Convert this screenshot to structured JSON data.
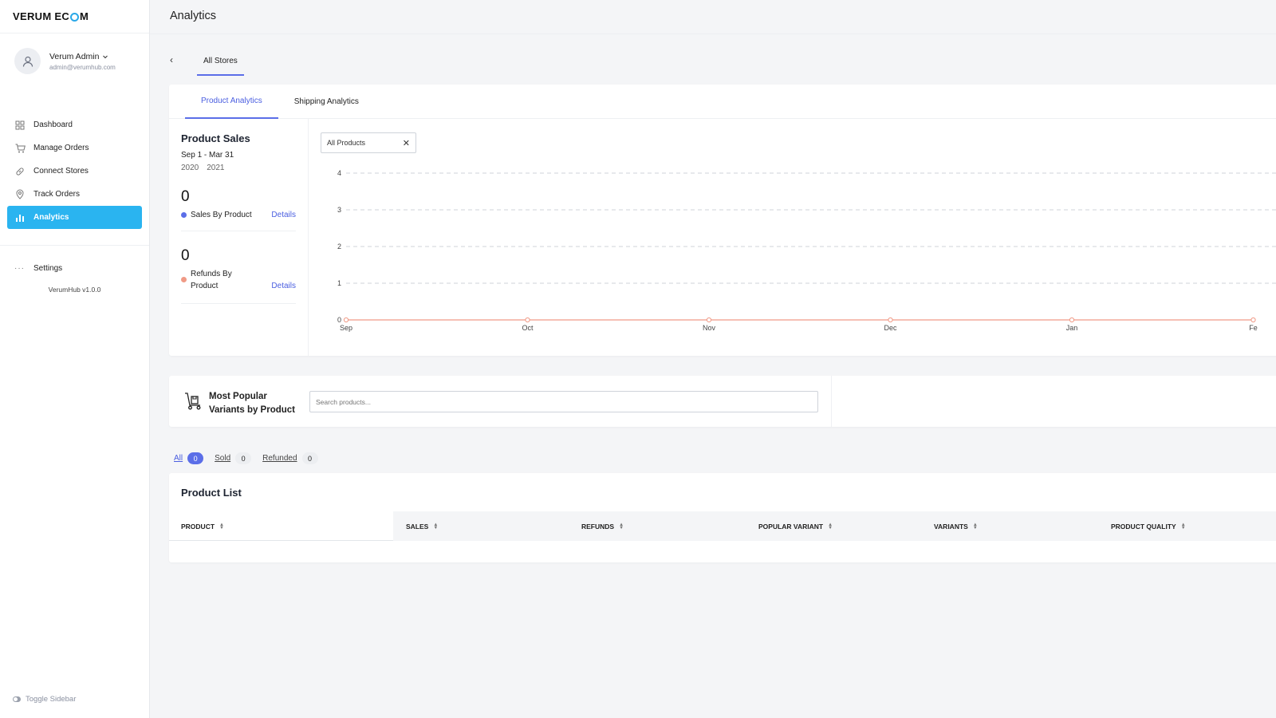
{
  "sidebar": {
    "logo_left": "VERUM EC",
    "logo_right": "M",
    "user": {
      "name": "Verum Admin",
      "email": "admin@verumhub.com"
    },
    "nav": [
      {
        "label": "Dashboard",
        "icon": "grid-icon"
      },
      {
        "label": "Manage Orders",
        "icon": "cart-icon"
      },
      {
        "label": "Connect Stores",
        "icon": "link-icon"
      },
      {
        "label": "Track Orders",
        "icon": "location-pin-icon"
      },
      {
        "label": "Analytics",
        "icon": "bar-chart-icon",
        "active": true
      }
    ],
    "settings": "Settings",
    "version": "VerumHub v1.0.0",
    "toggle": "Toggle Sidebar"
  },
  "header": {
    "title": "Analytics"
  },
  "store_tabs": {
    "active": "All Stores"
  },
  "analytics": {
    "tabs": [
      "Product Analytics",
      "Shipping Analytics"
    ],
    "summary": {
      "title": "Product Sales",
      "range": "Sep 1 - Mar 31",
      "year_start": "2020",
      "year_end": "2021",
      "sales_value": "0",
      "sales_label": "Sales By Product",
      "refunds_value": "0",
      "refunds_label": "Refunds By Product",
      "details": "Details"
    },
    "filter": "All Products"
  },
  "chart_data": {
    "type": "line",
    "categories": [
      "Sep",
      "Oct",
      "Nov",
      "Dec",
      "Jan",
      "Fe"
    ],
    "series": [
      {
        "values": [
          0,
          0,
          0,
          0,
          0,
          0
        ],
        "color": "#f09a86"
      }
    ],
    "ylim": [
      0,
      4
    ],
    "yticks": [
      0,
      1,
      2,
      3,
      4
    ],
    "grid": true
  },
  "variants": {
    "title_line1": "Most Popular",
    "title_line2": "Variants by Product",
    "search_placeholder": "Search products..."
  },
  "list_filters": [
    {
      "label": "All",
      "count": "0",
      "active": true
    },
    {
      "label": "Sold",
      "count": "0"
    },
    {
      "label": "Refunded",
      "count": "0"
    }
  ],
  "product_list": {
    "title": "Product List",
    "columns": [
      "PRODUCT",
      "SALES",
      "REFUNDS",
      "POPULAR VARIANT",
      "VARIANTS",
      "PRODUCT QUALITY"
    ]
  },
  "colors": {
    "accent": "#2ab4f0",
    "primary": "#5b6ee8",
    "sales_dot": "#5b6ee8",
    "refund_dot": "#f09a86"
  }
}
